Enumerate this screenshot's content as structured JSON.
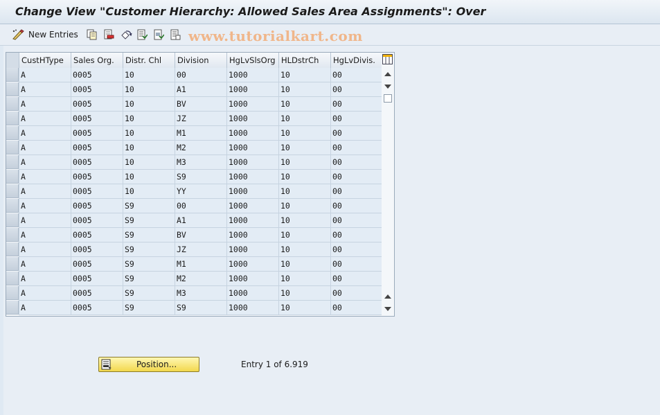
{
  "window": {
    "title": "Change View \"Customer Hierarchy: Allowed Sales Area Assignments\": Over"
  },
  "toolbar": {
    "new_entries_label": "New Entries",
    "watermark": "www.tutorialkart.com",
    "icons": [
      "select-edit-icon",
      "copy-icon",
      "delete-icon",
      "undo-icon",
      "select-all-icon",
      "select-block-icon",
      "deselect-all-icon"
    ]
  },
  "table": {
    "columns": [
      "CustHType",
      "Sales Org.",
      "Distr. Chl",
      "Division",
      "HgLvSlsOrg",
      "HLDstrCh",
      "HgLvDivis."
    ],
    "rows": [
      [
        "A",
        "0005",
        "10",
        "00",
        "1000",
        "10",
        "00"
      ],
      [
        "A",
        "0005",
        "10",
        "A1",
        "1000",
        "10",
        "00"
      ],
      [
        "A",
        "0005",
        "10",
        "BV",
        "1000",
        "10",
        "00"
      ],
      [
        "A",
        "0005",
        "10",
        "JZ",
        "1000",
        "10",
        "00"
      ],
      [
        "A",
        "0005",
        "10",
        "M1",
        "1000",
        "10",
        "00"
      ],
      [
        "A",
        "0005",
        "10",
        "M2",
        "1000",
        "10",
        "00"
      ],
      [
        "A",
        "0005",
        "10",
        "M3",
        "1000",
        "10",
        "00"
      ],
      [
        "A",
        "0005",
        "10",
        "S9",
        "1000",
        "10",
        "00"
      ],
      [
        "A",
        "0005",
        "10",
        "YY",
        "1000",
        "10",
        "00"
      ],
      [
        "A",
        "0005",
        "S9",
        "00",
        "1000",
        "10",
        "00"
      ],
      [
        "A",
        "0005",
        "S9",
        "A1",
        "1000",
        "10",
        "00"
      ],
      [
        "A",
        "0005",
        "S9",
        "BV",
        "1000",
        "10",
        "00"
      ],
      [
        "A",
        "0005",
        "S9",
        "JZ",
        "1000",
        "10",
        "00"
      ],
      [
        "A",
        "0005",
        "S9",
        "M1",
        "1000",
        "10",
        "00"
      ],
      [
        "A",
        "0005",
        "S9",
        "M2",
        "1000",
        "10",
        "00"
      ],
      [
        "A",
        "0005",
        "S9",
        "M3",
        "1000",
        "10",
        "00"
      ],
      [
        "A",
        "0005",
        "S9",
        "S9",
        "1000",
        "10",
        "00"
      ]
    ]
  },
  "footer": {
    "position_button_label": "Position...",
    "entry_info": "Entry 1 of 6.919"
  }
}
